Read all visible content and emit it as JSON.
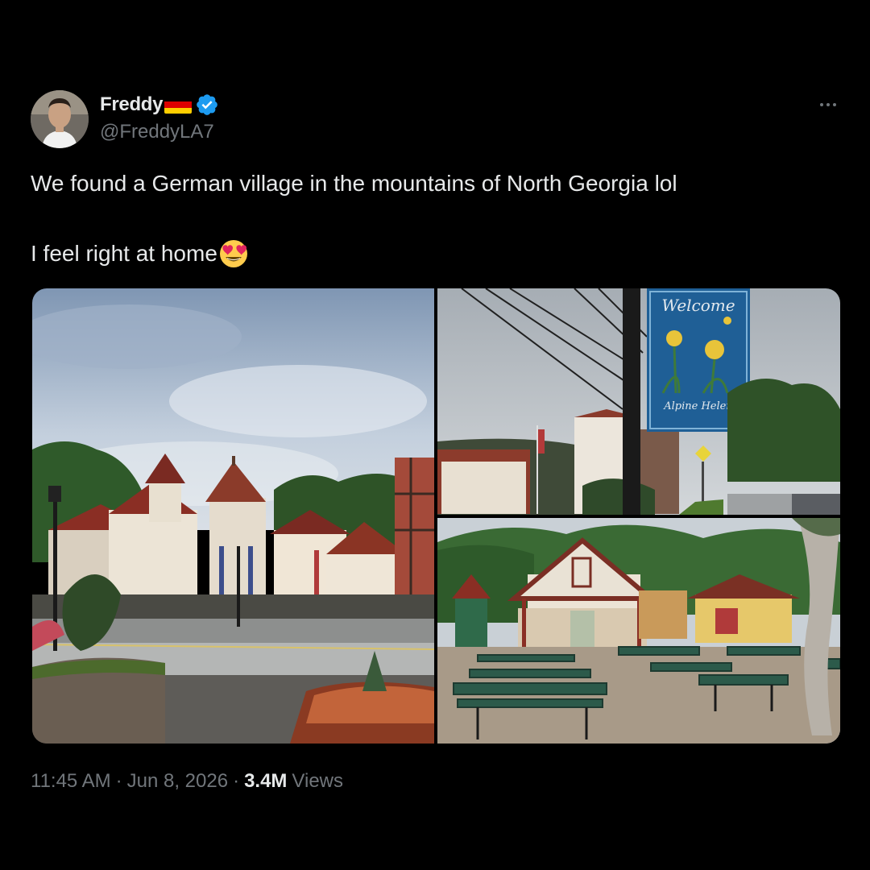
{
  "post": {
    "author": {
      "display_name": "Freddy",
      "handle": "@FreddyLA7",
      "verified": true,
      "flag_colors": [
        "#000000",
        "#dd0000",
        "#ffce00"
      ],
      "verified_color": "#1d9bf0"
    },
    "more_icon": "more-horizontal-icon",
    "text_line1": "We found a German village in the mountains of North Georgia lol",
    "text_line2": "I feel right at home",
    "emoji": "heart-eyes-emoji",
    "timestamp_time": "11:45 AM",
    "timestamp_date": "Jun 8, 2026",
    "separator": "·",
    "views_count": "3.4M",
    "views_label": "Views"
  },
  "media": {
    "photo2_sign": {
      "line1": "Welcome",
      "line2": "Alpine Helen"
    }
  },
  "colors": {
    "background": "#000000",
    "primary_text": "#e7e9ea",
    "secondary_text": "#71767b"
  }
}
